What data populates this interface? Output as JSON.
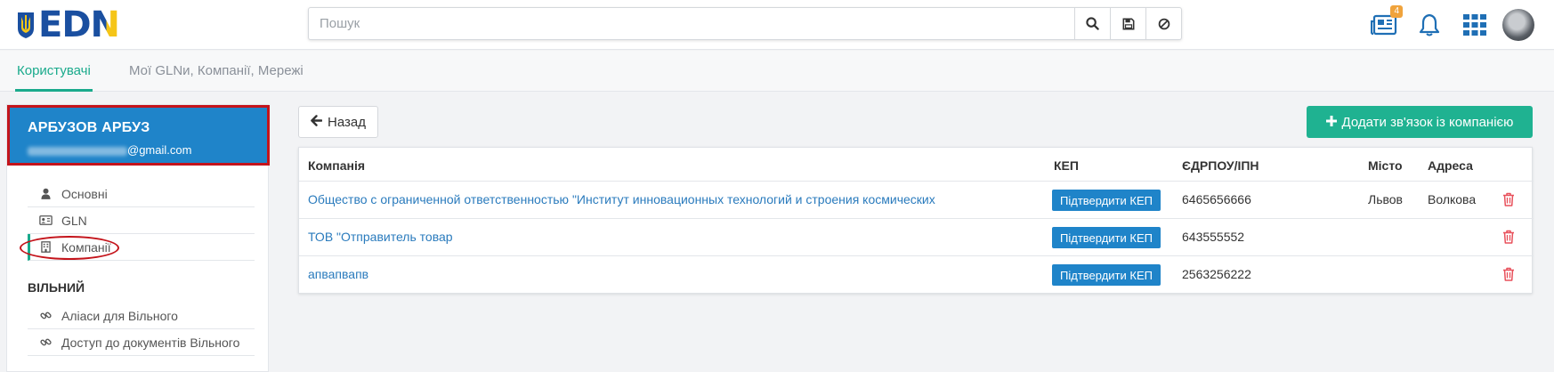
{
  "header": {
    "logo_text": "EDIN",
    "logo_letters": [
      "E",
      "D",
      "N"
    ],
    "search": {
      "placeholder": "Пошук"
    },
    "news_badge": "4",
    "icons": [
      "search-icon",
      "save-icon",
      "clear-icon",
      "news-icon",
      "bell-icon",
      "apps-grid-icon",
      "avatar"
    ]
  },
  "tabs": [
    {
      "label": "Користувачі",
      "active": true
    },
    {
      "label": "Мої GLNи, Компанії, Мережі",
      "active": false
    }
  ],
  "sidebar": {
    "user_name": "АРБУЗОВ АРБУЗ",
    "user_email_suffix": "@gmail.com",
    "items": [
      {
        "label": "Основні",
        "icon": "user-icon"
      },
      {
        "label": "GLN",
        "icon": "id-card-icon"
      },
      {
        "label": "Компанії",
        "icon": "building-icon",
        "active": true
      }
    ],
    "section_title": "ВІЛЬНИЙ",
    "section_items": [
      {
        "label": "Аліаси для Вільного",
        "icon": "link-icon"
      },
      {
        "label": "Доступ до документів Вільного",
        "icon": "link-icon"
      }
    ]
  },
  "main": {
    "back_label": "Назад",
    "add_label": "Додати зв'язок із компанією",
    "table": {
      "headers": {
        "company": "Компанія",
        "kep": "КЕП",
        "edrpou": "ЄДРПОУ/ІПН",
        "city": "Місто",
        "address": "Адреса"
      },
      "kep_button_label": "Підтвердити КЕП",
      "rows": [
        {
          "company": "Общество с ограниченной ответственностью \"Институт инновационных технологий и строения космических",
          "edrpou": "6465656666",
          "city": "Львов",
          "address": "Волкова"
        },
        {
          "company": "ТОВ \"Отправитель товар",
          "edrpou": "643555552",
          "city": "",
          "address": ""
        },
        {
          "company": "апвапвапв",
          "edrpou": "2563256222",
          "city": "",
          "address": ""
        }
      ]
    }
  },
  "colors": {
    "accent_green": "#1aaa8c",
    "primary_blue": "#1f84c9",
    "link_blue": "#2a7bbd",
    "annotation_red": "#c4141b",
    "badge_orange": "#f0a33c",
    "trash_red": "#e8505b"
  }
}
